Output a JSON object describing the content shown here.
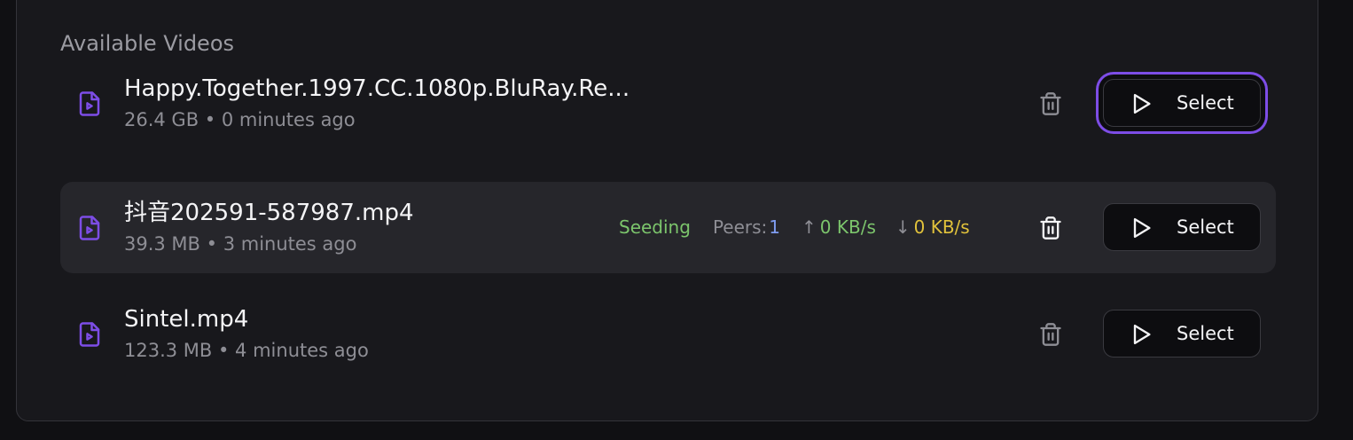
{
  "section": {
    "title": "Available Videos"
  },
  "videos": [
    {
      "name": "Happy.Together.1997.CC.1080p.BluRay.Re...",
      "meta": "26.4 GB • 0 minutes ago",
      "select_label": "Select"
    },
    {
      "name": "抖音202591-587987.mp4",
      "meta": "39.3 MB • 3 minutes ago",
      "status": "Seeding",
      "peers_label": "Peers:",
      "peers_count": "1",
      "upload_arrow": "↑",
      "upload_rate": "0 KB/s",
      "download_arrow": "↓",
      "download_rate": "0 KB/s",
      "select_label": "Select"
    },
    {
      "name": "Sintel.mp4",
      "meta": "123.3 MB • 4 minutes ago",
      "select_label": "Select"
    }
  ],
  "colors": {
    "accent": "#7d4de6",
    "seeding": "#7cc56c",
    "peers": "#7f9cf0",
    "download": "#e1c23b"
  },
  "icons": {
    "file": "file-video-icon",
    "trash": "trash-icon",
    "play": "play-icon"
  }
}
